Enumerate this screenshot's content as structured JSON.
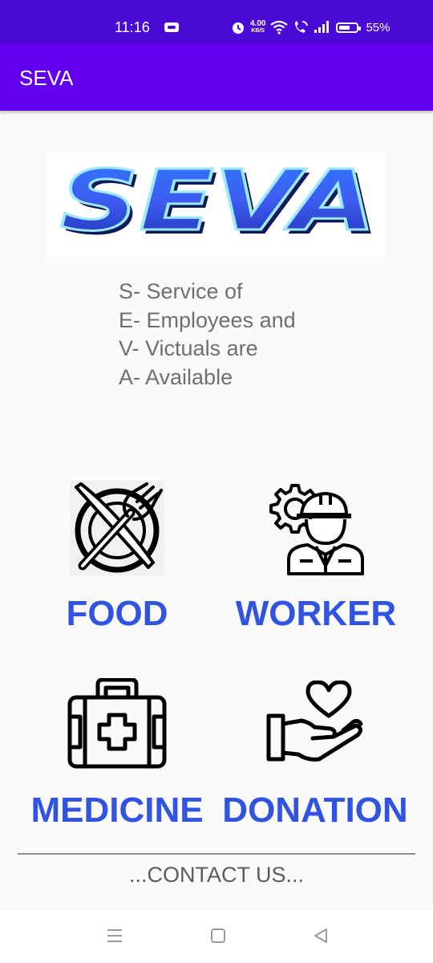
{
  "status_bar": {
    "time": "11:16",
    "speed_value": "4.00",
    "speed_unit": "KB/S",
    "battery": "55%"
  },
  "app_bar": {
    "title": "SEVA"
  },
  "logo": {
    "text": "SEVA",
    "colors": {
      "fill": "#2f5cf0",
      "glow": "#8fe6ff"
    }
  },
  "tagline": [
    "S- Service of",
    "E- Employees and",
    "V- Victuals are",
    "A- Available"
  ],
  "tiles": {
    "food": {
      "label": "FOOD",
      "icon": "plate-cutlery-icon"
    },
    "worker": {
      "label": "WORKER",
      "icon": "worker-gear-icon"
    },
    "medicine": {
      "label": "MEDICINE",
      "icon": "first-aid-kit-icon"
    },
    "donation": {
      "label": "DONATION",
      "icon": "heart-hand-icon"
    }
  },
  "footer": {
    "contact": "...CONTACT US..."
  },
  "colors": {
    "status_bar": "#4a0ad6",
    "app_bar": "#6200ee",
    "tile_label": "#3154e0"
  }
}
